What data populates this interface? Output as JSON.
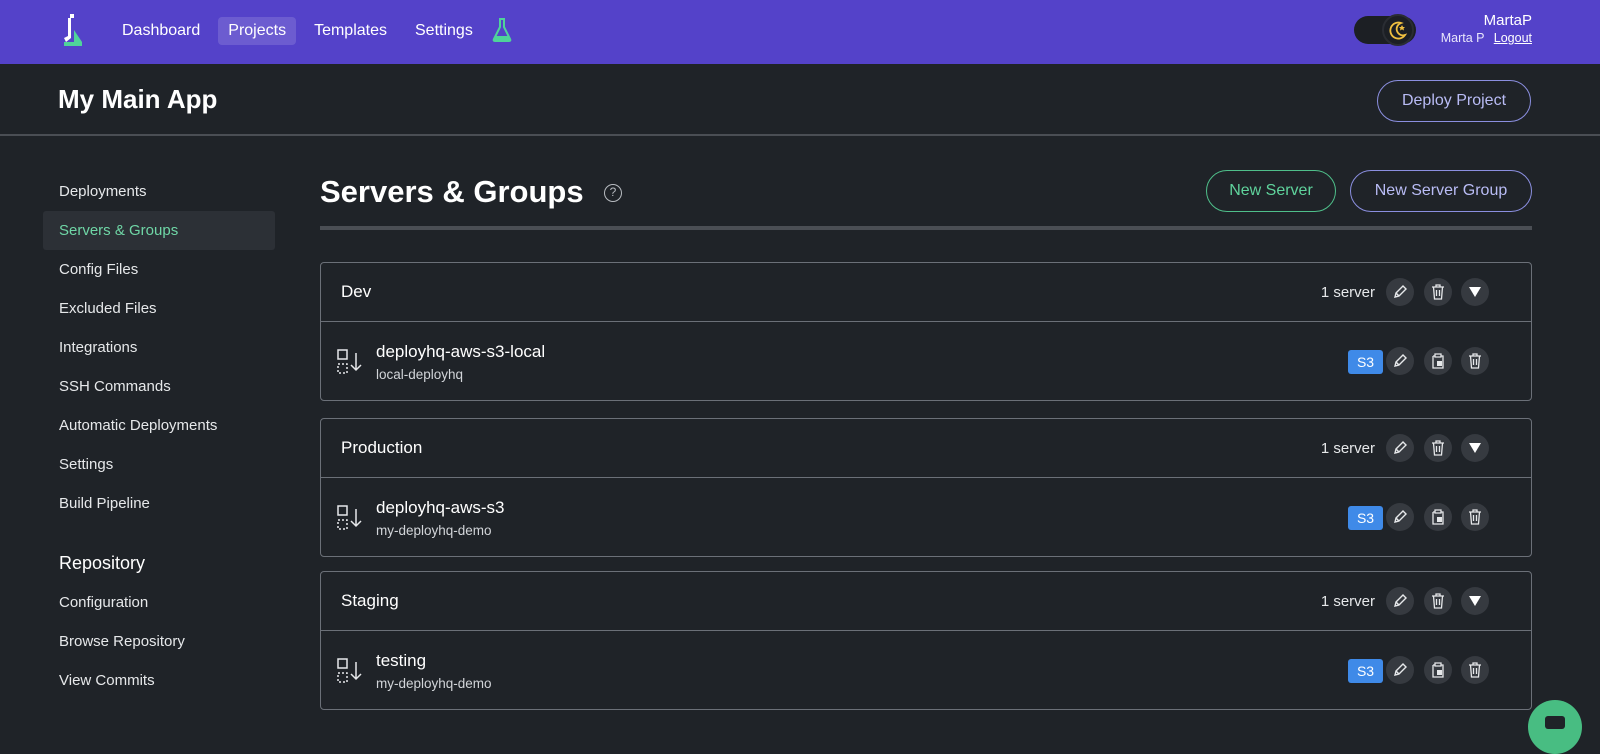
{
  "colors": {
    "nav_bg": "#5442c9",
    "page_bg": "#1f2328",
    "accent_green": "#5fd39c",
    "accent_purple": "#b9bcf5",
    "s3_badge": "#3f8ae8"
  },
  "nav": {
    "logo_icon": "deployhq-logo-icon",
    "links": [
      "Dashboard",
      "Projects",
      "Templates",
      "Settings"
    ],
    "active_link": "Projects",
    "lab_icon": "flask-icon",
    "theme_toggle_icon": "moon-icon",
    "user": {
      "username": "MartaP",
      "full_name": "Marta P",
      "logout_label": "Logout"
    }
  },
  "header": {
    "title": "My Main App",
    "deploy_label": "Deploy Project"
  },
  "sidebar": {
    "items": [
      "Deployments",
      "Servers & Groups",
      "Config Files",
      "Excluded Files",
      "Integrations",
      "SSH Commands",
      "Automatic Deployments",
      "Settings",
      "Build Pipeline"
    ],
    "active_item": "Servers & Groups",
    "repository_heading": "Repository",
    "repository_items": [
      "Configuration",
      "Browse Repository",
      "View Commits"
    ]
  },
  "main": {
    "title": "Servers & Groups",
    "help_glyph": "?",
    "new_server_label": "New Server",
    "new_group_label": "New Server Group",
    "groups": [
      {
        "name": "Dev",
        "count": "1 server",
        "server": {
          "name": "deployhq-aws-s3-local",
          "bucket": "local-deployhq",
          "protocol": "S3"
        }
      },
      {
        "name": "Production",
        "count": "1 server",
        "server": {
          "name": "deployhq-aws-s3",
          "bucket": "my-deployhq-demo",
          "protocol": "S3"
        }
      },
      {
        "name": "Staging",
        "count": "1 server",
        "server": {
          "name": "testing",
          "bucket": "my-deployhq-demo",
          "protocol": "S3"
        }
      }
    ]
  }
}
